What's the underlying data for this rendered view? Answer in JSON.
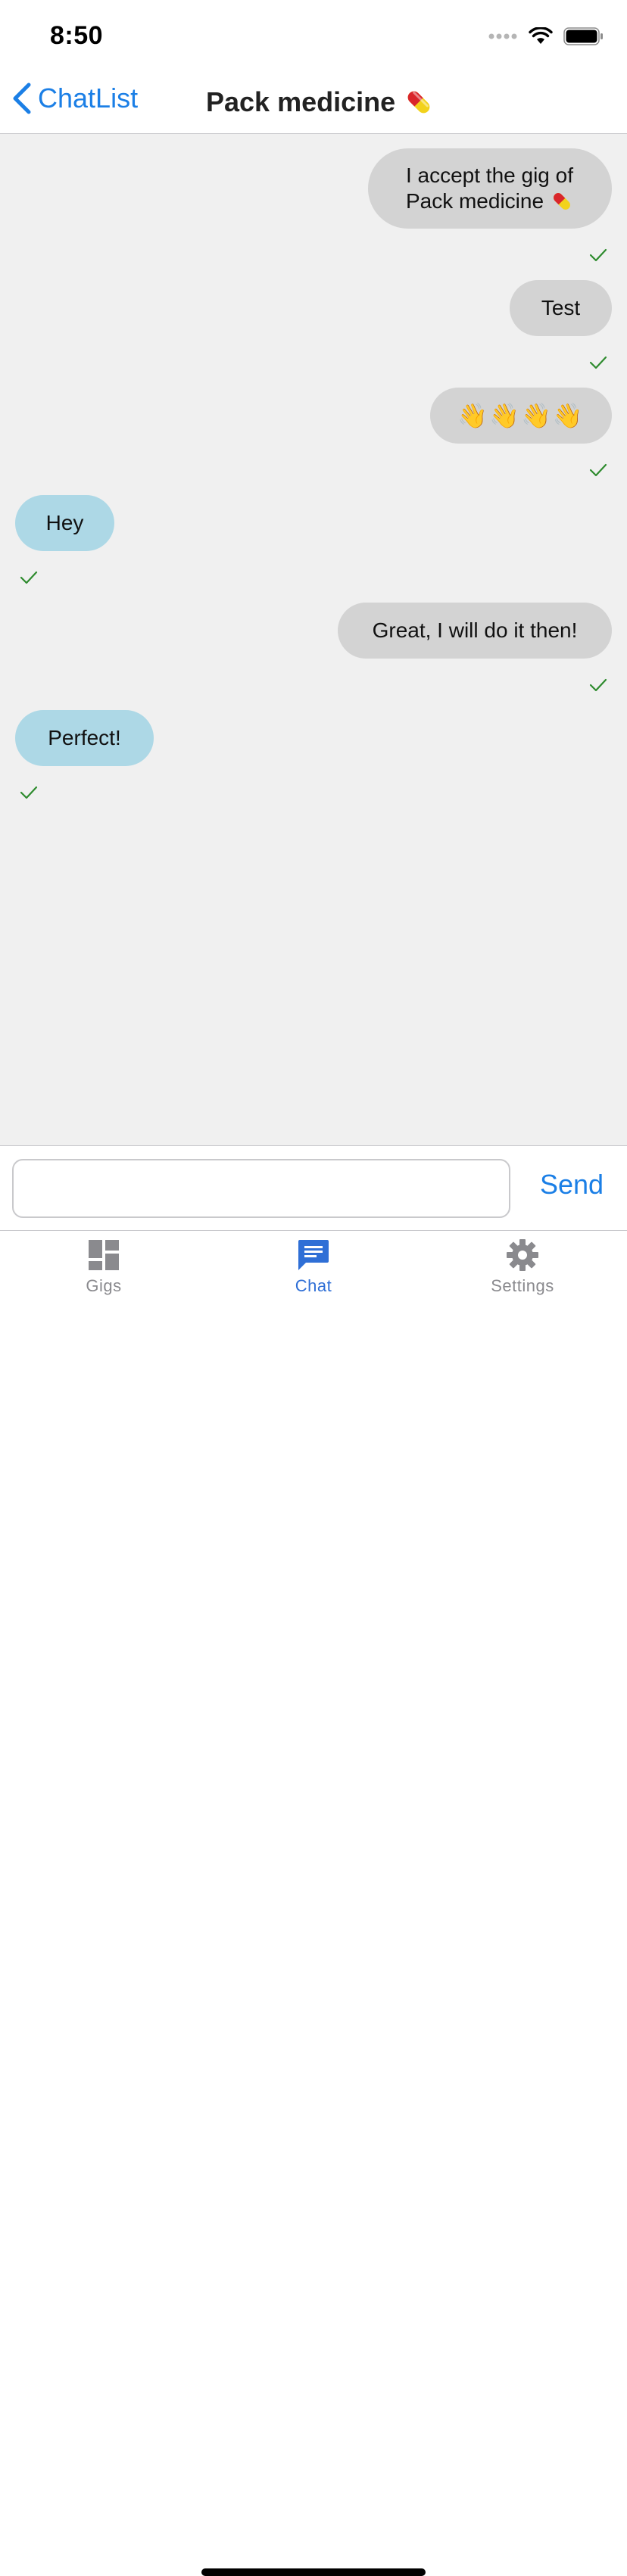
{
  "status_bar": {
    "time": "8:50",
    "icons": [
      "signal-icon",
      "wifi-icon",
      "battery-icon"
    ]
  },
  "nav": {
    "back_label": "ChatList",
    "title": "Pack medicine",
    "title_icon": "pill-icon"
  },
  "messages": [
    {
      "text_line1": "I accept the gig of",
      "text_line2": "Pack medicine",
      "icon": "pill-icon",
      "direction": "outgoing",
      "status": "delivered"
    },
    {
      "text": "Test",
      "direction": "outgoing",
      "status": "delivered"
    },
    {
      "text": "👋👋👋👋",
      "direction": "outgoing",
      "status": "delivered"
    },
    {
      "text": "Hey",
      "direction": "incoming",
      "status": "delivered"
    },
    {
      "text": "Great, I will do it then!",
      "direction": "outgoing",
      "status": "delivered"
    },
    {
      "text": "Perfect!",
      "direction": "incoming",
      "status": "delivered"
    }
  ],
  "composer": {
    "value": "",
    "placeholder": "",
    "send_label": "Send"
  },
  "tabs": [
    {
      "label": "Gigs",
      "icon": "dashboard-icon",
      "active": false
    },
    {
      "label": "Chat",
      "icon": "chat-icon",
      "active": true
    },
    {
      "label": "Settings",
      "icon": "gear-icon",
      "active": false
    }
  ],
  "colors": {
    "accent": "#1b7fe6",
    "active_tab": "#2f6fd6",
    "outgoing_bubble": "#d3d3d3",
    "incoming_bubble": "#add8e6",
    "check": "#2e8b2e",
    "chat_background": "#f0f0f0"
  }
}
